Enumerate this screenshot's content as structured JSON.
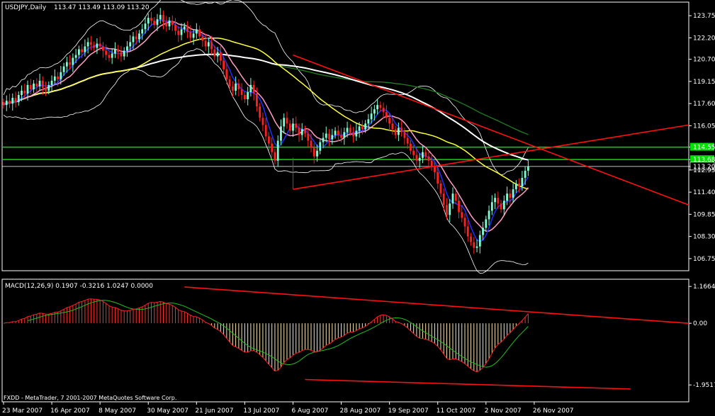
{
  "header": {
    "symbol_label": "USDJPY,Daily",
    "ohlc_label": "113.47 113.49 113.09 113.20"
  },
  "macd_header": {
    "label": "MACD(12,26,9) 0.1907 -0.3216 1.0247 0.0000"
  },
  "footer": {
    "copyright": "FXDD - MetaTrader, 7 2001-2007 MetaQuotes Software Corp."
  },
  "colors": {
    "background": "#000000",
    "axis": "#ffffff",
    "bull_candle": "#7fffd4",
    "bear_candle": "#ff2020",
    "ma_blue": "#2030ff",
    "ma_pink": "#ff9ec8",
    "ma_yellow": "#ffff40",
    "ma_white": "#ffffff",
    "ma_green": "#208020",
    "bollinger": "#ffffff",
    "hline_green": "#00e000",
    "trend_red": "#ff1010",
    "macd_hist_pos": "#ff3030",
    "macd_hist_neg": "#ffe8b0",
    "macd_signal": "#20c020",
    "macd_line": "#ff2020"
  },
  "chart_data": {
    "type": "candlestick",
    "symbol": "USDJPY",
    "timeframe": "Daily",
    "price_panel": {
      "ylim": [
        106.0,
        124.6
      ],
      "ticks": [
        "123.75",
        "122.20",
        "120.70",
        "119.15",
        "117.60",
        "116.05",
        "114.55",
        "113.68",
        "113.20",
        "112.95",
        "111.40",
        "109.85",
        "108.30",
        "106.75"
      ],
      "tick_values": [
        123.75,
        122.2,
        120.7,
        119.15,
        117.6,
        116.05,
        114.55,
        113.68,
        113.2,
        112.95,
        111.4,
        109.85,
        108.3,
        106.75
      ],
      "highlighted_levels": [
        {
          "label": "114.55",
          "value": 114.55
        },
        {
          "label": "113.68",
          "value": 113.68
        },
        {
          "label": "113.20",
          "value": 113.2
        }
      ],
      "horizontal_lines": [
        114.55,
        113.68,
        113.2
      ],
      "last_close": 113.2
    },
    "macd_panel": {
      "ylim": [
        -2.15,
        1.35
      ],
      "ticks": [
        "1.1664",
        "0.00",
        "-1.9517"
      ],
      "tick_values": [
        1.1664,
        0.0,
        -1.9517
      ]
    },
    "x_labels": [
      "23 Mar 2007",
      "16 Apr 2007",
      "8 May 2007",
      "30 May 2007",
      "21 Jun 2007",
      "13 Jul 2007",
      "6 Aug 2007",
      "28 Aug 2007",
      "19 Sep 2007",
      "11 Oct 2007",
      "2 Nov 2007",
      "26 Nov 2007"
    ],
    "x_label_index": [
      0,
      16,
      32,
      48,
      64,
      80,
      96,
      112,
      128,
      144,
      160,
      176
    ],
    "close": [
      117.5,
      117.8,
      117.6,
      118.0,
      117.7,
      118.2,
      118.5,
      118.3,
      118.9,
      118.6,
      119.0,
      118.8,
      119.2,
      118.7,
      118.5,
      118.9,
      119.2,
      119.5,
      119.3,
      119.8,
      120.2,
      120.5,
      120.3,
      120.8,
      121.0,
      121.4,
      121.2,
      121.6,
      121.9,
      121.7,
      121.5,
      121.8,
      121.6,
      121.3,
      121.0,
      120.8,
      121.1,
      121.4,
      121.2,
      120.9,
      121.3,
      121.6,
      121.9,
      122.3,
      122.1,
      122.5,
      122.8,
      123.2,
      123.6,
      123.4,
      123.1,
      123.5,
      123.8,
      123.3,
      123.0,
      123.4,
      123.1,
      122.7,
      122.4,
      122.8,
      123.0,
      122.6,
      122.2,
      122.5,
      122.8,
      122.3,
      122.0,
      121.6,
      121.9,
      121.4,
      120.9,
      121.2,
      120.6,
      120.0,
      119.3,
      118.8,
      118.5,
      119.0,
      118.6,
      118.2,
      117.9,
      118.4,
      118.9,
      118.3,
      117.4,
      116.6,
      116.1,
      115.3,
      114.8,
      114.2,
      113.6,
      115.0,
      116.0,
      116.6,
      116.2,
      115.7,
      116.2,
      115.9,
      115.4,
      115.8,
      115.5,
      115.0,
      114.5,
      113.9,
      114.3,
      114.9,
      115.2,
      115.5,
      115.1,
      115.4,
      115.7,
      115.4,
      115.2,
      115.6,
      115.9,
      115.6,
      115.3,
      115.7,
      116.0,
      115.8,
      116.2,
      116.5,
      116.9,
      117.2,
      117.5,
      117.3,
      117.0,
      116.6,
      116.2,
      115.8,
      115.4,
      115.9,
      115.6,
      115.2,
      114.8,
      114.3,
      114.0,
      113.6,
      113.8,
      114.2,
      113.9,
      113.6,
      113.2,
      112.8,
      112.0,
      111.3,
      110.5,
      109.8,
      110.6,
      111.3,
      110.8,
      110.0,
      109.6,
      109.0,
      108.3,
      107.9,
      107.5,
      107.6,
      108.4,
      108.9,
      109.5,
      110.1,
      110.7,
      111.0,
      110.6,
      110.2,
      110.8,
      111.3,
      111.0,
      111.6,
      112.0,
      111.8,
      112.4,
      112.9,
      113.2
    ]
  }
}
